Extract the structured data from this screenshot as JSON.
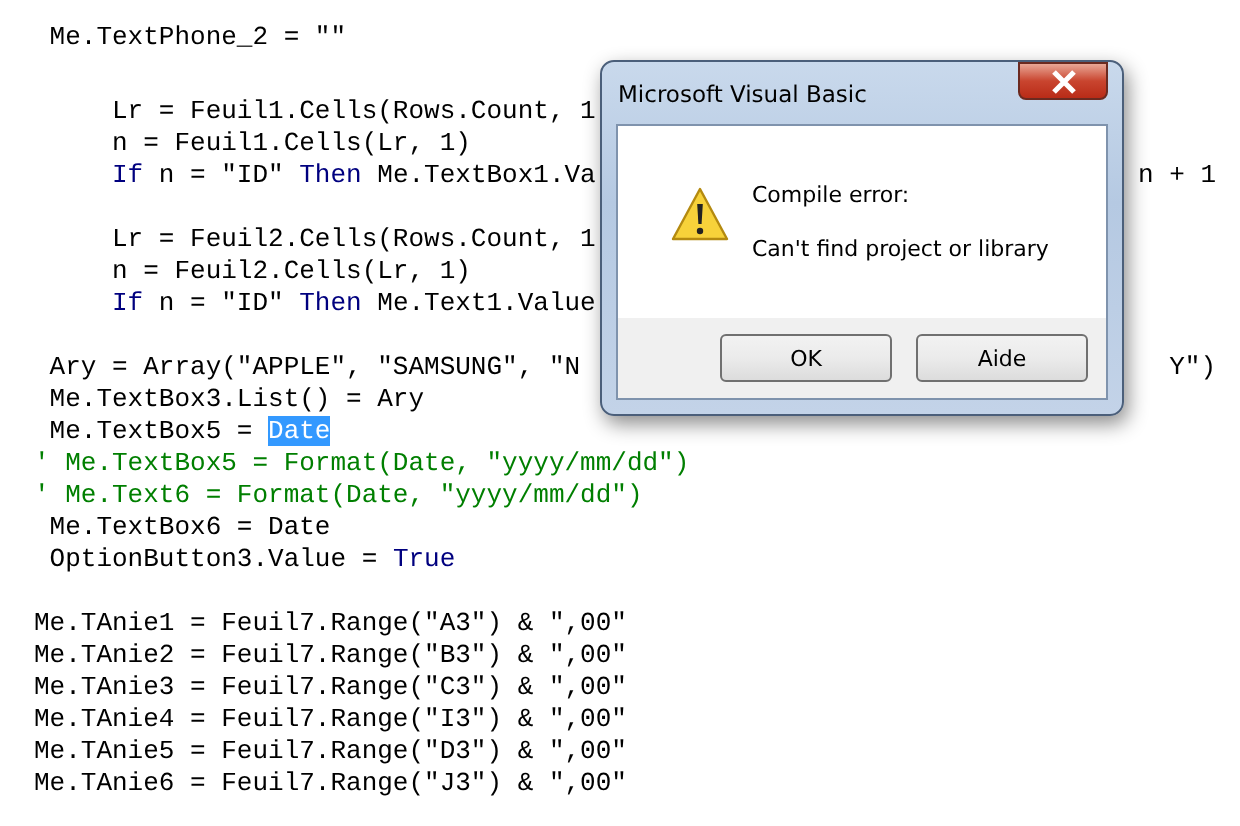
{
  "editor": {
    "blocks": [
      [
        {
          "tokens": [
            {
              "kind": "plain",
              "text": " Me.TextPhone_2 = \"\""
            }
          ]
        }
      ],
      [
        {
          "tokens": [
            {
              "kind": "plain",
              "text": "     Lr = Feuil1.Cells(Rows.Count, 1"
            }
          ]
        },
        {
          "tokens": [
            {
              "kind": "plain",
              "text": "     n = Feuil1.Cells(Lr, 1)"
            }
          ]
        },
        {
          "tokens": [
            {
              "kind": "keyword",
              "text": "     If"
            },
            {
              "kind": "plain",
              "text": " n = \"ID\" "
            },
            {
              "kind": "keyword",
              "text": "Then"
            },
            {
              "kind": "plain",
              "text": " Me.TextBox1.Va"
            }
          ],
          "tail": "n + 1"
        }
      ],
      [
        {
          "tokens": [
            {
              "kind": "plain",
              "text": "     Lr = Feuil2.Cells(Rows.Count, 1"
            }
          ]
        },
        {
          "tokens": [
            {
              "kind": "plain",
              "text": "     n = Feuil2.Cells(Lr, 1)"
            }
          ]
        },
        {
          "tokens": [
            {
              "kind": "keyword",
              "text": "     If"
            },
            {
              "kind": "plain",
              "text": " n = \"ID\" "
            },
            {
              "kind": "keyword",
              "text": "Then"
            },
            {
              "kind": "plain",
              "text": " Me.Text1.Value"
            }
          ]
        }
      ],
      [
        {
          "tokens": [
            {
              "kind": "plain",
              "text": " Ary = Array(\"APPLE\", \"SAMSUNG\", \"N"
            }
          ],
          "tail": "Y\")"
        },
        {
          "tokens": [
            {
              "kind": "plain",
              "text": " Me.TextBox3.List() = Ary"
            }
          ]
        },
        {
          "tokens": [
            {
              "kind": "plain",
              "text": " Me.TextBox5 = "
            },
            {
              "kind": "selected",
              "text": "Date"
            }
          ]
        },
        {
          "tokens": [
            {
              "kind": "comment",
              "text": "' Me.TextBox5 = Format(Date, \"yyyy/mm/dd\")"
            }
          ]
        },
        {
          "tokens": [
            {
              "kind": "comment",
              "text": "' Me.Text6 = Format(Date, \"yyyy/mm/dd\")"
            }
          ]
        },
        {
          "tokens": [
            {
              "kind": "plain",
              "text": " Me.TextBox6 = Date"
            }
          ]
        },
        {
          "tokens": [
            {
              "kind": "plain",
              "text": " OptionButton3.Value = "
            },
            {
              "kind": "keyword",
              "text": "True"
            }
          ]
        }
      ],
      [
        {
          "tokens": [
            {
              "kind": "plain",
              "text": "Me.TAnie1 = Feuil7.Range(\"A3\") & \",00\""
            }
          ]
        },
        {
          "tokens": [
            {
              "kind": "plain",
              "text": "Me.TAnie2 = Feuil7.Range(\"B3\") & \",00\""
            }
          ]
        },
        {
          "tokens": [
            {
              "kind": "plain",
              "text": "Me.TAnie3 = Feuil7.Range(\"C3\") & \",00\""
            }
          ]
        },
        {
          "tokens": [
            {
              "kind": "plain",
              "text": "Me.TAnie4 = Feuil7.Range(\"I3\") & \",00\""
            }
          ]
        },
        {
          "tokens": [
            {
              "kind": "plain",
              "text": "Me.TAnie5 = Feuil7.Range(\"D3\") & \",00\""
            }
          ]
        },
        {
          "tokens": [
            {
              "kind": "plain",
              "text": "Me.TAnie6 = Feuil7.Range(\"J3\") & \",00\""
            }
          ]
        }
      ]
    ]
  },
  "dialog": {
    "title": "Microsoft Visual Basic",
    "heading": "Compile error:",
    "message": "Can't find project or library",
    "buttons": [
      "OK",
      "Aide"
    ]
  }
}
